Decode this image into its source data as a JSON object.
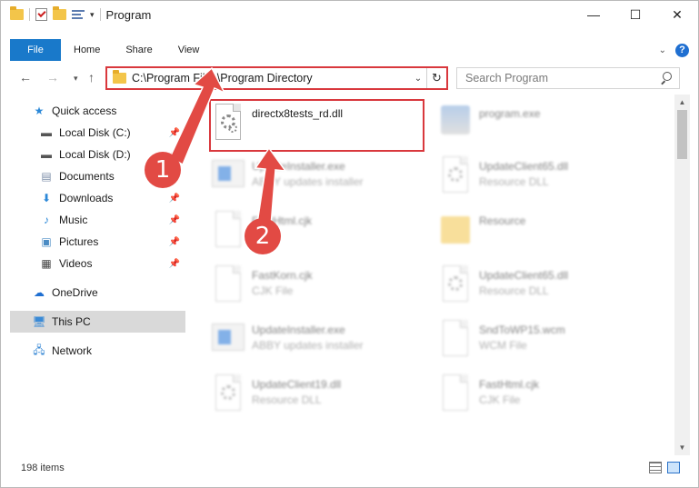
{
  "window": {
    "title": "Program",
    "controls": {
      "minimize": "—",
      "maximize": "☐",
      "close": "✕"
    }
  },
  "ribbon": {
    "tabs": [
      "File",
      "Home",
      "Share",
      "View"
    ],
    "help": "?"
  },
  "address": {
    "path": "C:\\Program Files\\Program Directory",
    "search_placeholder": "Search Program"
  },
  "sidebar": {
    "items": [
      {
        "label": "Quick access",
        "icon": "star-icon",
        "pinned": false
      },
      {
        "label": "Local Disk (C:)",
        "icon": "drive-icon",
        "pinned": true
      },
      {
        "label": "Local Disk (D:)",
        "icon": "drive-icon",
        "pinned": true
      },
      {
        "label": "Documents",
        "icon": "documents-icon",
        "pinned": true
      },
      {
        "label": "Downloads",
        "icon": "download-icon",
        "pinned": true
      },
      {
        "label": "Music",
        "icon": "music-icon",
        "pinned": true
      },
      {
        "label": "Pictures",
        "icon": "pictures-icon",
        "pinned": true
      },
      {
        "label": "Videos",
        "icon": "video-icon",
        "pinned": true
      },
      {
        "label": "OneDrive",
        "icon": "cloud-icon",
        "pinned": false
      },
      {
        "label": "This PC",
        "icon": "computer-icon",
        "pinned": false
      },
      {
        "label": "Network",
        "icon": "network-icon",
        "pinned": false
      }
    ]
  },
  "files": [
    {
      "name": "directx8tests_rd.dll",
      "desc": "",
      "icon": "dll-icon",
      "highlighted": true
    },
    {
      "name": "program.exe",
      "desc": "",
      "icon": "program-icon"
    },
    {
      "name": "UpdateInstaller.exe",
      "desc": "ABBY updates installer",
      "icon": "exe-icon"
    },
    {
      "name": "UpdateClient65.dll",
      "desc": "Resource DLL",
      "icon": "dll-icon"
    },
    {
      "name": "FastHtml.cjk",
      "desc": "File",
      "icon": "file-icon"
    },
    {
      "name": "Resource",
      "desc": "",
      "icon": "folder-icon"
    },
    {
      "name": "FastKorn.cjk",
      "desc": "CJK File",
      "icon": "file-icon"
    },
    {
      "name": "UpdateClient65.dll",
      "desc": "Resource DLL",
      "icon": "dll-icon"
    },
    {
      "name": "UpdateInstaller.exe",
      "desc": "ABBY updates installer",
      "icon": "exe-icon"
    },
    {
      "name": "SndToWP15.wcm",
      "desc": "WCM File",
      "icon": "file-icon"
    },
    {
      "name": "UpdateClient19.dll",
      "desc": "Resource DLL",
      "icon": "dll-icon"
    },
    {
      "name": "FastHtml.cjk",
      "desc": "CJK File",
      "icon": "file-icon"
    }
  ],
  "status": {
    "items_count": "198 items"
  },
  "annotations": {
    "step1": "1",
    "step2": "2",
    "color": "#e24a44"
  }
}
